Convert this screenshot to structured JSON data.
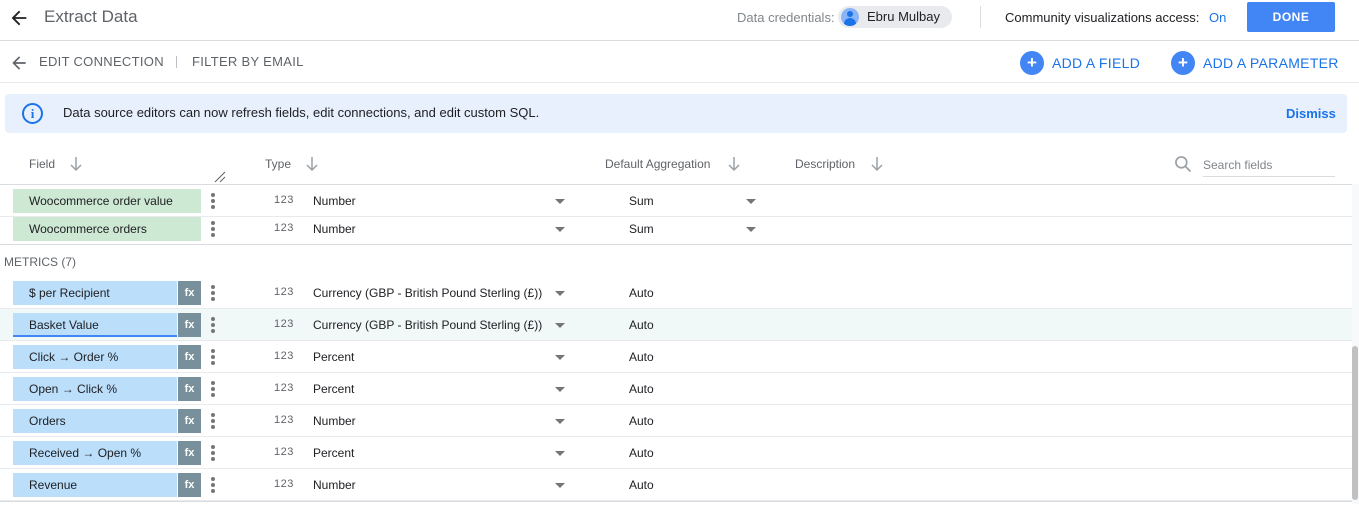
{
  "topbar": {
    "title": "Extract Data",
    "credentials_label": "Data credentials:",
    "credentials_user": "Ebru Mulbay",
    "community_label": "Community visualizations access:",
    "community_value": "On",
    "done_label": "DONE"
  },
  "subbar": {
    "edit_connection": "EDIT CONNECTION",
    "filter_by_email": "FILTER BY EMAIL",
    "add_field": "ADD A FIELD",
    "add_parameter": "ADD A PARAMETER"
  },
  "banner": {
    "text": "Data source editors can now refresh fields, edit connections, and edit custom SQL.",
    "dismiss": "Dismiss"
  },
  "table": {
    "headers": {
      "field": "Field",
      "type": "Type",
      "aggregation": "Default Aggregation",
      "description": "Description"
    },
    "search_placeholder": "Search fields",
    "type_icon": "123",
    "fx_label": "fx",
    "dimensions": [
      {
        "name": "Woocommerce order value",
        "type": "Number",
        "aggregation": "Sum"
      },
      {
        "name": "Woocommerce orders",
        "type": "Number",
        "aggregation": "Sum"
      }
    ],
    "metrics_label": "METRICS (7)",
    "metrics": [
      {
        "name": "$ per Recipient",
        "type": "Currency (GBP - British Pound Sterling (£))",
        "aggregation": "Auto"
      },
      {
        "name": "Basket Value",
        "type": "Currency (GBP - British Pound Sterling (£))",
        "aggregation": "Auto"
      },
      {
        "name": "Click → Order %",
        "type": "Percent",
        "aggregation": "Auto"
      },
      {
        "name": "Open → Click %",
        "type": "Percent",
        "aggregation": "Auto"
      },
      {
        "name": "Orders",
        "type": "Number",
        "aggregation": "Auto"
      },
      {
        "name": "Received → Open %",
        "type": "Percent",
        "aggregation": "Auto"
      },
      {
        "name": "Revenue",
        "type": "Number",
        "aggregation": "Auto"
      }
    ]
  },
  "colors": {
    "accent": "#1a73e8",
    "button": "#4285f4",
    "dimension_chip": "#cde8d3",
    "metric_chip": "#bbdefb",
    "fx_badge": "#78909c"
  }
}
